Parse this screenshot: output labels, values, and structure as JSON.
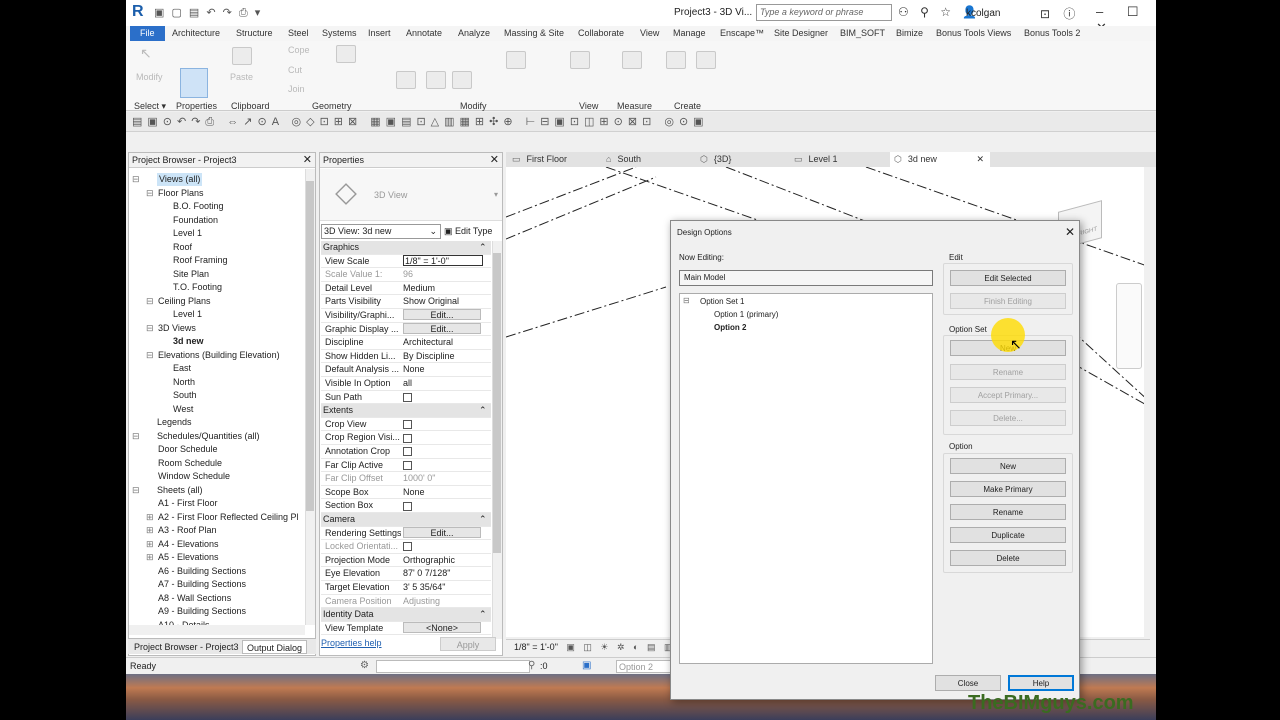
{
  "app": {
    "doc_title": "Project3 - 3D Vi...",
    "search_placeholder": "Type a keyword or phrase",
    "user": "kcolgan"
  },
  "ribbon_tabs": [
    "File",
    "Architecture",
    "Structure",
    "Steel",
    "Systems",
    "Insert",
    "Annotate",
    "Analyze",
    "Massing & Site",
    "Collaborate",
    "View",
    "Manage",
    "Enscape™",
    "Site Designer",
    "BIM_SOFT",
    "Bimize",
    "Bonus Tools Views",
    "Bonus Tools 2"
  ],
  "ribbon": {
    "modify": "Modify",
    "select": "Select ▾",
    "properties": "Properties",
    "paste": "Paste",
    "clipboard": "Clipboard",
    "cope": "Cope",
    "cut": "Cut",
    "join": "Join",
    "geometry": "Geometry",
    "modify_group": "Modify",
    "view": "View",
    "measure": "Measure",
    "create": "Create"
  },
  "project_browser": {
    "title": "Project Browser - Project3",
    "items": [
      {
        "label": "Views (all)",
        "indent": 0,
        "toggle": "⊟",
        "sel": true
      },
      {
        "label": "Floor Plans",
        "indent": 1,
        "toggle": "⊟"
      },
      {
        "label": "B.O. Footing",
        "indent": 2
      },
      {
        "label": "Foundation",
        "indent": 2
      },
      {
        "label": "Level 1",
        "indent": 2
      },
      {
        "label": "Roof",
        "indent": 2
      },
      {
        "label": "Roof Framing",
        "indent": 2
      },
      {
        "label": "Site Plan",
        "indent": 2
      },
      {
        "label": "T.O. Footing",
        "indent": 2
      },
      {
        "label": "Ceiling Plans",
        "indent": 1,
        "toggle": "⊟"
      },
      {
        "label": "Level 1",
        "indent": 2
      },
      {
        "label": "3D Views",
        "indent": 1,
        "toggle": "⊟"
      },
      {
        "label": "3d new",
        "indent": 2,
        "bold": true
      },
      {
        "label": "Elevations (Building Elevation)",
        "indent": 1,
        "toggle": "⊟"
      },
      {
        "label": "East",
        "indent": 2
      },
      {
        "label": "North",
        "indent": 2
      },
      {
        "label": "South",
        "indent": 2
      },
      {
        "label": "West",
        "indent": 2
      },
      {
        "label": "Legends",
        "indent": 0
      },
      {
        "label": "Schedules/Quantities (all)",
        "indent": 0,
        "toggle": "⊟"
      },
      {
        "label": "Door Schedule",
        "indent": 1
      },
      {
        "label": "Room Schedule",
        "indent": 1
      },
      {
        "label": "Window Schedule",
        "indent": 1
      },
      {
        "label": "Sheets (all)",
        "indent": 0,
        "toggle": "⊟"
      },
      {
        "label": "A1 - First Floor",
        "indent": 1
      },
      {
        "label": "A2 - First Floor Reflected Ceiling Pl",
        "indent": 1,
        "toggle": "⊞"
      },
      {
        "label": "A3 - Roof Plan",
        "indent": 1,
        "toggle": "⊞"
      },
      {
        "label": "A4 - Elevations",
        "indent": 1,
        "toggle": "⊞"
      },
      {
        "label": "A5 - Elevations",
        "indent": 1,
        "toggle": "⊞"
      },
      {
        "label": "A6 - Building Sections",
        "indent": 1
      },
      {
        "label": "A7 - Building Sections",
        "indent": 1
      },
      {
        "label": "A8 - Wall Sections",
        "indent": 1
      },
      {
        "label": "A9 - Building Sections",
        "indent": 1
      },
      {
        "label": "A10 - Details",
        "indent": 1
      }
    ],
    "tabs": [
      "Project Browser - Project3",
      "Output Dialog"
    ]
  },
  "properties": {
    "title": "Properties",
    "type_label": "3D View",
    "view_selector": "3D View: 3d new",
    "edit_type": "Edit Type",
    "help": "Properties help",
    "apply": "Apply",
    "rows": [
      {
        "k": "Graphics",
        "sec": true
      },
      {
        "k": "View Scale",
        "v": "1/8\" = 1'-0\"",
        "input": true
      },
      {
        "k": "Scale Value    1:",
        "v": "96",
        "dim": true
      },
      {
        "k": "Detail Level",
        "v": "Medium"
      },
      {
        "k": "Parts Visibility",
        "v": "Show Original"
      },
      {
        "k": "Visibility/Graphi...",
        "v": "Edit...",
        "btn": true
      },
      {
        "k": "Graphic Display ...",
        "v": "Edit...",
        "btn": true
      },
      {
        "k": "Discipline",
        "v": "Architectural"
      },
      {
        "k": "Show Hidden Li...",
        "v": "By Discipline"
      },
      {
        "k": "Default Analysis ...",
        "v": "None"
      },
      {
        "k": "Visible In Option",
        "v": "all"
      },
      {
        "k": "Sun Path",
        "chk": true
      },
      {
        "k": "Extents",
        "sec": true
      },
      {
        "k": "Crop View",
        "chk": true
      },
      {
        "k": "Crop Region Visi...",
        "chk": true
      },
      {
        "k": "Annotation Crop",
        "chk": true
      },
      {
        "k": "Far Clip Active",
        "chk": true
      },
      {
        "k": "Far Clip Offset",
        "v": "1000'  0\"",
        "dim": true
      },
      {
        "k": "Scope Box",
        "v": "None"
      },
      {
        "k": "Section Box",
        "chk": true
      },
      {
        "k": "Camera",
        "sec": true
      },
      {
        "k": "Rendering Settings",
        "v": "Edit...",
        "btn": true
      },
      {
        "k": "Locked Orientati...",
        "dim": true,
        "chk": true
      },
      {
        "k": "Projection Mode",
        "v": "Orthographic"
      },
      {
        "k": "Eye Elevation",
        "v": "87'  0 7/128\""
      },
      {
        "k": "Target Elevation",
        "v": "3'  5 35/64\""
      },
      {
        "k": "Camera Position",
        "v": "Adjusting",
        "dim": true
      },
      {
        "k": "Identity Data",
        "sec": true
      },
      {
        "k": "View Template",
        "v": "<None>",
        "btn": true
      }
    ]
  },
  "view_tabs": [
    {
      "label": "First Floor",
      "icon": "▭"
    },
    {
      "label": "South",
      "icon": "⌂"
    },
    {
      "label": "{3D}",
      "icon": "⬡"
    },
    {
      "label": "Level 1",
      "icon": "▭"
    },
    {
      "label": "3d new",
      "icon": "⬡",
      "active": true
    }
  ],
  "view_control": {
    "scale": "1/8\" = 1'-0\""
  },
  "status": {
    "text": "Ready",
    "zero": ":0",
    "option": "Option 2"
  },
  "viewcube": {
    "face": "RIGHT"
  },
  "dialog": {
    "title": "Design Options",
    "now_editing_label": "Now Editing:",
    "now_editing": "Main Model",
    "tree": {
      "set": "Option Set 1",
      "opt1": "Option 1 (primary)",
      "opt2": "Option 2"
    },
    "edit_label": "Edit",
    "edit_selected": "Edit Selected",
    "finish_editing": "Finish Editing",
    "option_set_label": "Option Set",
    "set_new": "New",
    "set_rename": "Rename",
    "accept_primary": "Accept Primary...",
    "set_delete": "Delete...",
    "option_label": "Option",
    "opt_new": "New",
    "make_primary": "Make Primary",
    "opt_rename": "Rename",
    "duplicate": "Duplicate",
    "opt_delete": "Delete",
    "close": "Close",
    "help": "Help"
  },
  "watermark": "TheBIMguys.com"
}
